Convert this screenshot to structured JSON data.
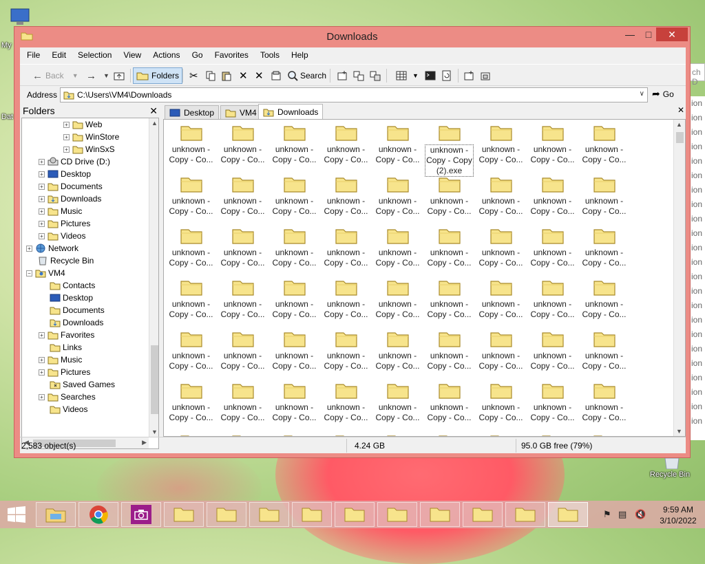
{
  "window": {
    "title": "Downloads"
  },
  "menu": [
    "File",
    "Edit",
    "Selection",
    "View",
    "Actions",
    "Go",
    "Favorites",
    "Tools",
    "Help"
  ],
  "toolbar": {
    "back_label": "Back",
    "folders_label": "Folders",
    "search_label": "Search"
  },
  "address": {
    "label": "Address",
    "path": "C:\\Users\\VM4\\Downloads",
    "go_label": "Go"
  },
  "folders_pane": {
    "title": "Folders",
    "tree": [
      {
        "label": "Web"
      },
      {
        "label": "WinStore"
      },
      {
        "label": "WinSxS"
      },
      {
        "label": "CD Drive (D:)"
      },
      {
        "label": "Desktop"
      },
      {
        "label": "Documents"
      },
      {
        "label": "Downloads"
      },
      {
        "label": "Music"
      },
      {
        "label": "Pictures"
      },
      {
        "label": "Videos"
      },
      {
        "label": "Network"
      },
      {
        "label": "Recycle Bin"
      },
      {
        "label": "VM4"
      },
      {
        "label": "Contacts"
      },
      {
        "label": "Desktop"
      },
      {
        "label": "Documents"
      },
      {
        "label": "Downloads"
      },
      {
        "label": "Favorites"
      },
      {
        "label": "Links"
      },
      {
        "label": "Music"
      },
      {
        "label": "Pictures"
      },
      {
        "label": "Saved Games"
      },
      {
        "label": "Searches"
      },
      {
        "label": "Videos"
      }
    ]
  },
  "tabs": [
    {
      "label": "Desktop"
    },
    {
      "label": "VM4"
    },
    {
      "label": "Downloads"
    }
  ],
  "files": {
    "line1": "unknown -",
    "line2": "Copy - Co...",
    "selected_line2": "Copy - Copy",
    "selected_line3": "(2).exe"
  },
  "status": {
    "objects": "2,583 object(s)",
    "size": "4.24 GB",
    "free": "95.0 GB free (79%)"
  },
  "desktop": {
    "left_label_1": "My",
    "left_label_2": "Dat",
    "recycle_label": "Recycle Bin",
    "right_strip_text": "ch D",
    "right_strip_item": "ion"
  },
  "clock": {
    "time": "9:59 AM",
    "date": "3/10/2022"
  },
  "colors": {
    "window_frame": "#ec8c85",
    "close_button": "#c7413c",
    "folder_fill": "#f7e48c"
  }
}
